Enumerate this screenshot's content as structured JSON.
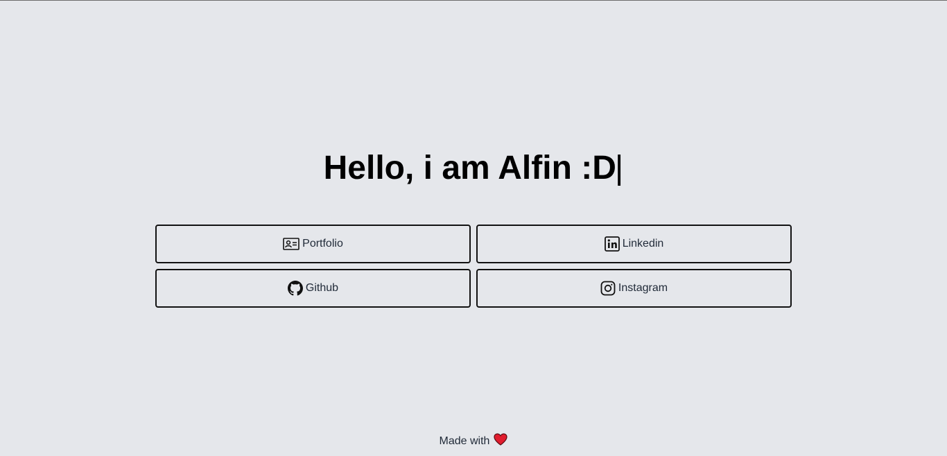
{
  "hero": {
    "title": "Hello, i am Alfin :D",
    "cursor": "|"
  },
  "links": [
    {
      "label": "Portfolio",
      "icon": "id-card-icon"
    },
    {
      "label": "Linkedin",
      "icon": "linkedin-icon"
    },
    {
      "label": "Github",
      "icon": "github-icon"
    },
    {
      "label": "Instagram",
      "icon": "instagram-icon"
    }
  ],
  "footer": {
    "text": "Made with",
    "icon": "heart-icon",
    "heart_color": "#e11d2e"
  },
  "colors": {
    "background": "#e5e7eb",
    "border": "#111111",
    "text": "#1f2937"
  }
}
